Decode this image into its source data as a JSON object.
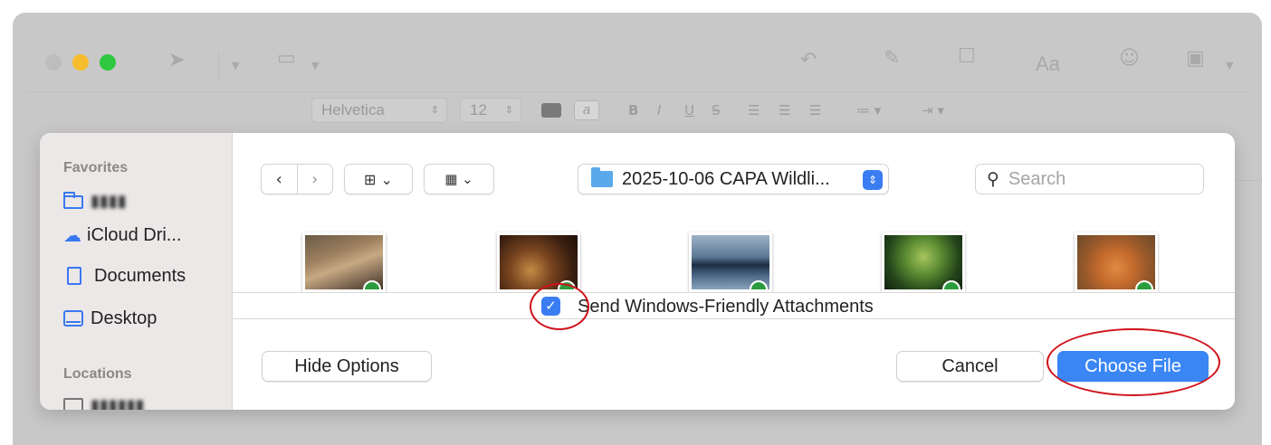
{
  "mail_toolbar": {
    "font_name": "Helvetica",
    "font_size": "12",
    "bold": "B",
    "italic": "I",
    "underline": "U",
    "strike": "S",
    "font_panel": "Aa"
  },
  "sidebar": {
    "favorites_heading": "Favorites",
    "favorites": [
      {
        "label": "iCloud Dri...",
        "icon": "cloud-icon"
      },
      {
        "label": "Documents",
        "icon": "document-icon"
      },
      {
        "label": "Desktop",
        "icon": "desktop-icon"
      }
    ],
    "locations_heading": "Locations"
  },
  "path_popup": {
    "label": "2025-10-06 CAPA Wildli..."
  },
  "search": {
    "placeholder": "Search"
  },
  "options": {
    "checkbox_label": "Send Windows-Friendly Attachments",
    "checked": true
  },
  "buttons": {
    "hide_options": "Hide Options",
    "cancel": "Cancel",
    "choose": "Choose File"
  },
  "colors": {
    "accent": "#3a86f5",
    "annotation": "#d0121b"
  }
}
